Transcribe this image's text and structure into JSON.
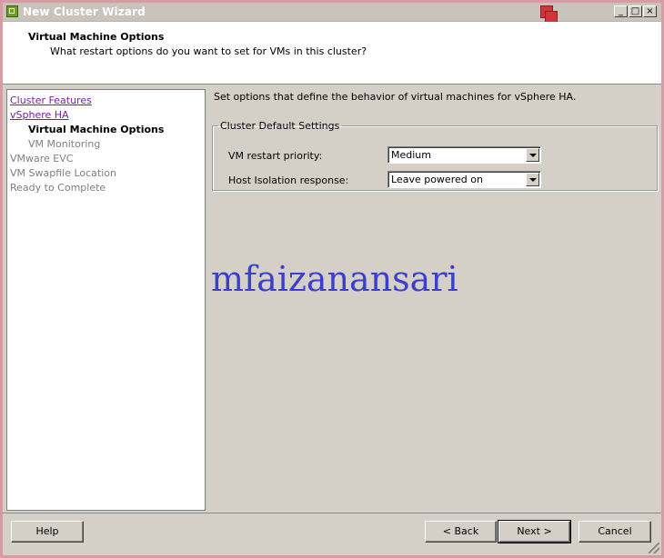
{
  "window": {
    "title": "New Cluster Wizard",
    "controls": {
      "minimize": "_",
      "maximize": "□",
      "close": "×"
    }
  },
  "header": {
    "title": "Virtual Machine Options",
    "subtitle": "What restart options do you want to set for VMs in this cluster?"
  },
  "nav": {
    "items": [
      {
        "label": "Cluster Features",
        "state": "link"
      },
      {
        "label": "vSphere HA",
        "state": "link"
      },
      {
        "label": "Virtual Machine Options",
        "state": "active"
      },
      {
        "label": "VM Monitoring",
        "state": "disabled"
      },
      {
        "label": "VMware EVC",
        "state": "disabled"
      },
      {
        "label": "VM Swapfile Location",
        "state": "disabled"
      },
      {
        "label": "Ready to Complete",
        "state": "disabled"
      }
    ]
  },
  "content": {
    "description": "Set options that define the behavior of virtual machines for vSphere HA.",
    "group": {
      "legend": "Cluster Default Settings",
      "restart_priority": {
        "label": "VM restart priority:",
        "value": "Medium"
      },
      "isolation_response": {
        "label": "Host Isolation response:",
        "value": "Leave powered on"
      }
    },
    "watermark": "mfaizanansari"
  },
  "footer": {
    "help": "Help",
    "back": "< Back",
    "next": "Next >",
    "cancel": "Cancel"
  },
  "colors": {
    "window_border": "#d99aa3",
    "link": "#7a1fa0",
    "watermark": "#3a3fcf"
  }
}
